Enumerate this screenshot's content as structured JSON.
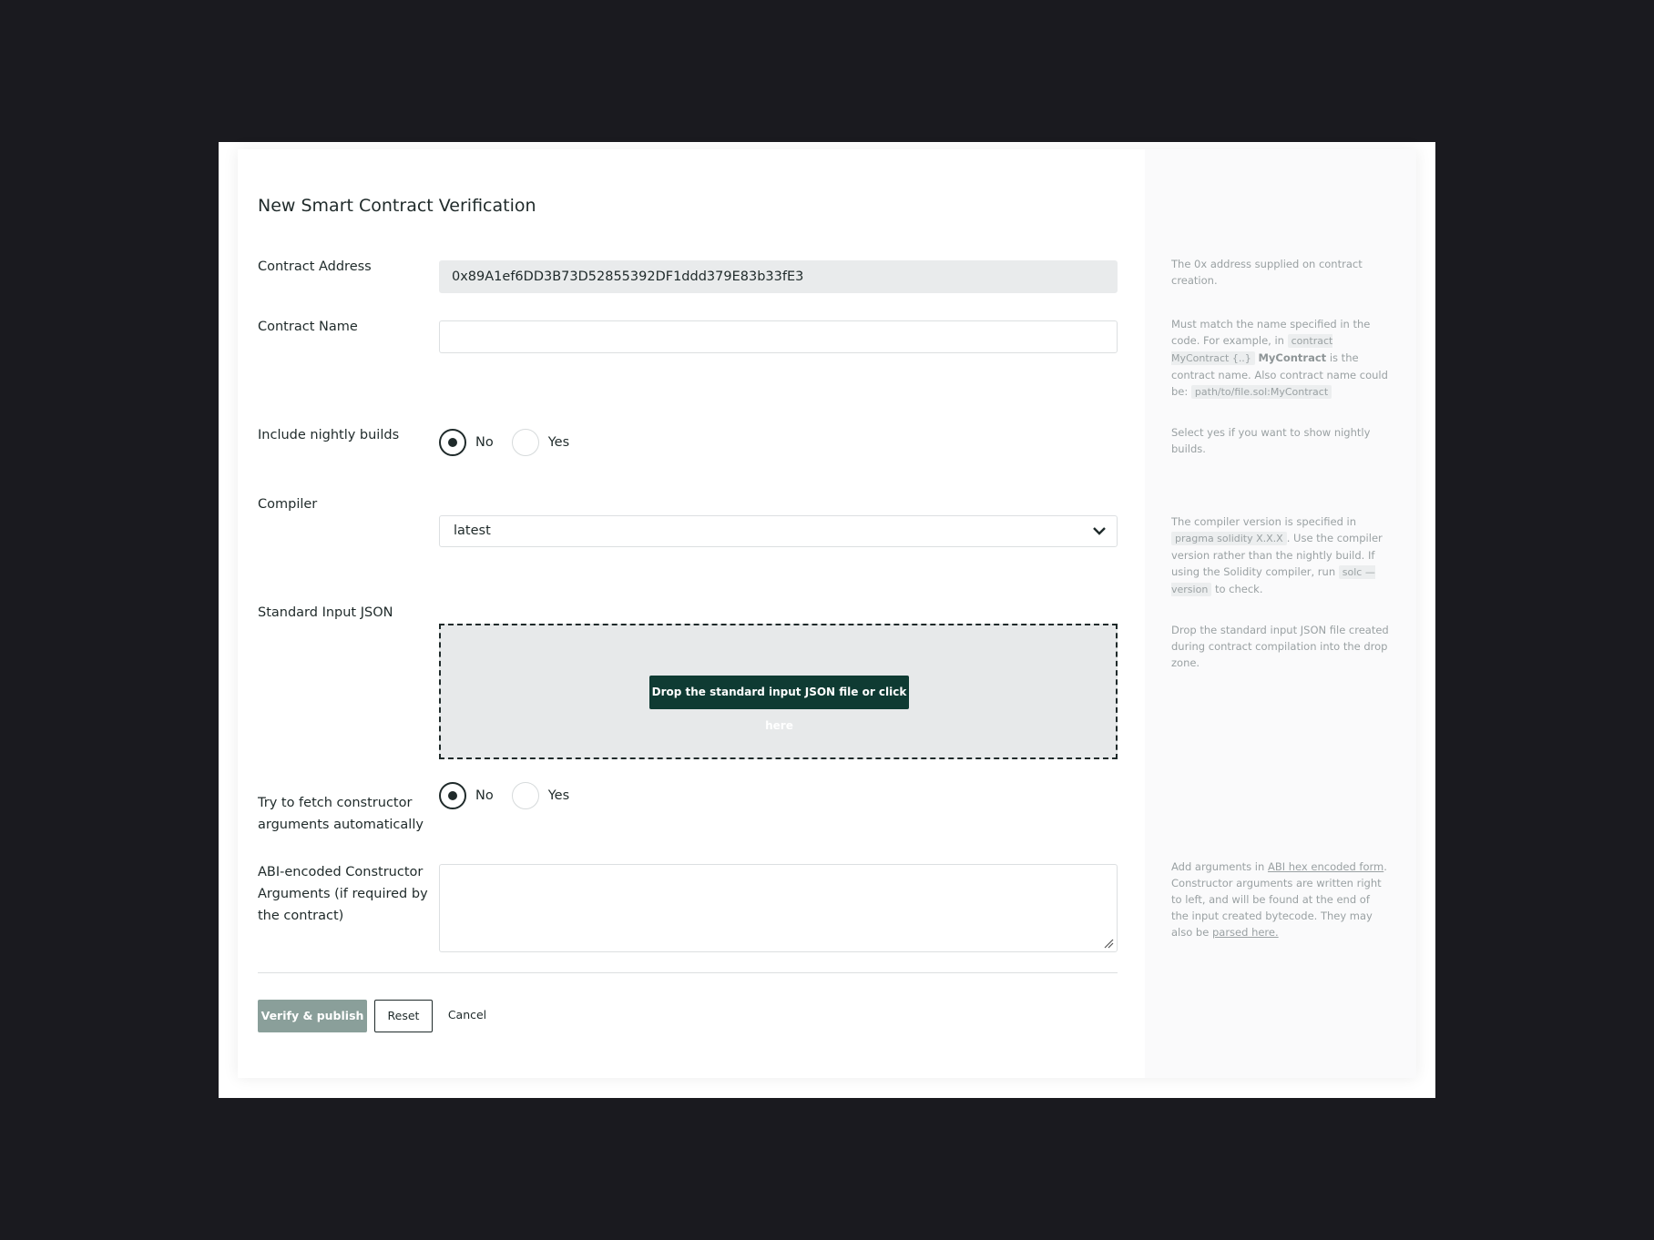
{
  "title": "New Smart Contract Verification",
  "fields": {
    "contract_address": {
      "label": "Contract Address",
      "value": "0x89A1ef6DD3B73D52855392DF1ddd379E83b33fE3",
      "hint": "The 0x address supplied on contract creation."
    },
    "contract_name": {
      "label": "Contract Name",
      "value": "",
      "hint": {
        "t1": "Must match the name specified in the code. For example, in ",
        "code1": "contract MyContract {..}",
        "bold1": "MyContract",
        "t2": " is the contract name. Also contract name could be: ",
        "code2": "path/to/file.sol:MyContract"
      }
    },
    "nightly_builds": {
      "label": "Include nightly builds",
      "options": [
        "No",
        "Yes"
      ],
      "selected": "No",
      "hint": "Select yes if you want to show nightly builds."
    },
    "compiler": {
      "label": "Compiler",
      "value": "latest",
      "hint": {
        "t1": "The compiler version is specified in ",
        "code1": "pragma solidity X.X.X",
        "t2": ". Use the compiler version rather than the nightly build. If using the Solidity compiler, run ",
        "code2": "solc —version",
        "t3": " to check."
      }
    },
    "standard_input_json": {
      "label": "Standard Input JSON",
      "button": "Drop the standard input JSON file or click here",
      "hint": "Drop the standard input JSON file created during contract compilation into the drop zone."
    },
    "fetch_constructor": {
      "label": "Try to fetch constructor arguments automatically",
      "options": [
        "No",
        "Yes"
      ],
      "selected": "No"
    },
    "constructor_args": {
      "label": "ABI-encoded Constructor Arguments (if required by the contract)",
      "value": "",
      "hint": {
        "t1": "Add arguments in ",
        "link1": "ABI hex encoded form",
        "t2": ". Constructor arguments are written right to left, and will be found at the end of the input created bytecode. They may also be ",
        "link2": "parsed here."
      }
    }
  },
  "actions": {
    "verify": "Verify & publish",
    "reset": "Reset",
    "cancel": "Cancel"
  }
}
